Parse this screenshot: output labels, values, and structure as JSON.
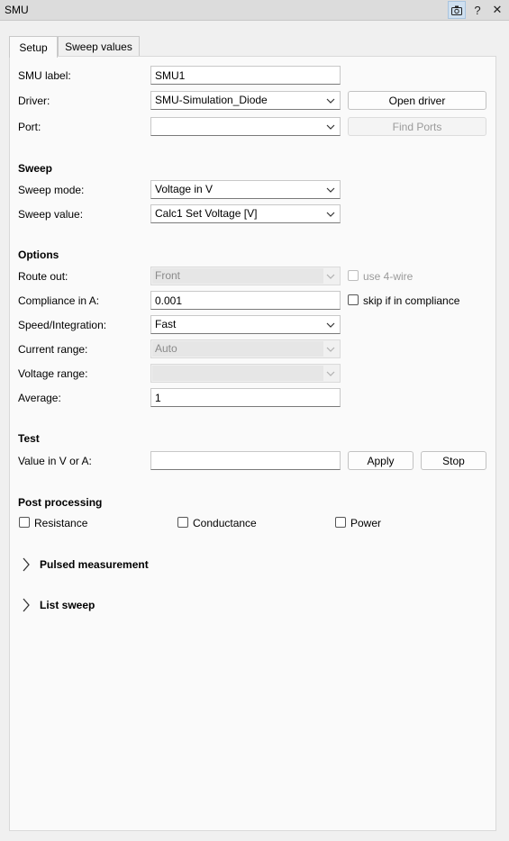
{
  "window": {
    "title": "SMU",
    "buttons": {
      "help": "?",
      "close": "✕"
    }
  },
  "tabs": [
    {
      "label": "Setup",
      "active": true
    },
    {
      "label": "Sweep values",
      "active": false
    }
  ],
  "general": {
    "smu_label": {
      "label": "SMU label:",
      "value": "SMU1"
    },
    "driver": {
      "label": "Driver:",
      "value": "SMU-Simulation_Diode",
      "button": "Open driver"
    },
    "port": {
      "label": "Port:",
      "value": "",
      "button": "Find Ports"
    }
  },
  "sweep": {
    "header": "Sweep",
    "mode": {
      "label": "Sweep mode:",
      "value": "Voltage in V"
    },
    "value": {
      "label": "Sweep value:",
      "value": "Calc1 Set Voltage [V]"
    }
  },
  "options": {
    "header": "Options",
    "route_out": {
      "label": "Route out:",
      "value": "Front",
      "checkbox": "use 4-wire"
    },
    "compliance": {
      "label": "Compliance in A:",
      "value": "0.001",
      "checkbox": "skip if in compliance"
    },
    "speed": {
      "label": "Speed/Integration:",
      "value": "Fast"
    },
    "current_range": {
      "label": "Current range:",
      "value": "Auto"
    },
    "voltage_range": {
      "label": "Voltage range:",
      "value": ""
    },
    "average": {
      "label": "Average:",
      "value": "1"
    }
  },
  "test": {
    "header": "Test",
    "value": {
      "label": "Value in V or A:",
      "value": ""
    },
    "apply": "Apply",
    "stop": "Stop"
  },
  "post_processing": {
    "header": "Post processing",
    "resistance": "Resistance",
    "conductance": "Conductance",
    "power": "Power"
  },
  "sections": {
    "pulsed": "Pulsed measurement",
    "list_sweep": "List sweep"
  }
}
